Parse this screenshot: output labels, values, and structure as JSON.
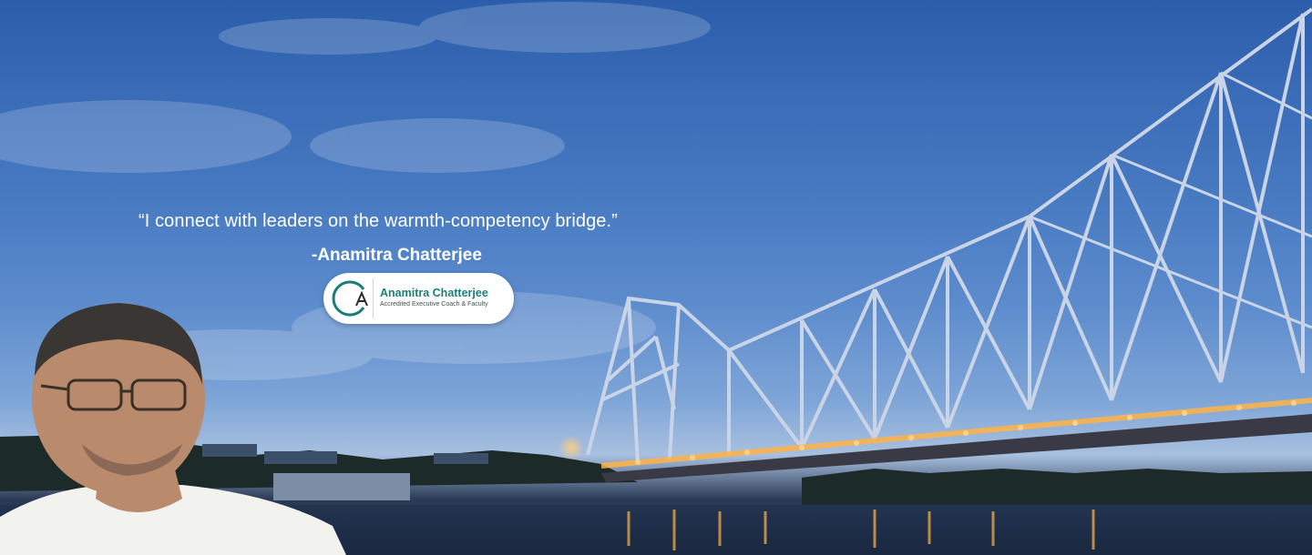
{
  "hero": {
    "quote": "“I connect with leaders on the warmth-competency bridge.”",
    "attribution": "-Anamitra Chatterjee"
  },
  "logo_badge": {
    "name": "Anamitra Chatterjee",
    "subtitle": "Accredited Executive Coach & Faculty",
    "accent_color": "#1b7f78"
  },
  "colors": {
    "sky_top": "#2b5dab",
    "bridge_lights": "#ffb347",
    "text": "#ffffff"
  }
}
